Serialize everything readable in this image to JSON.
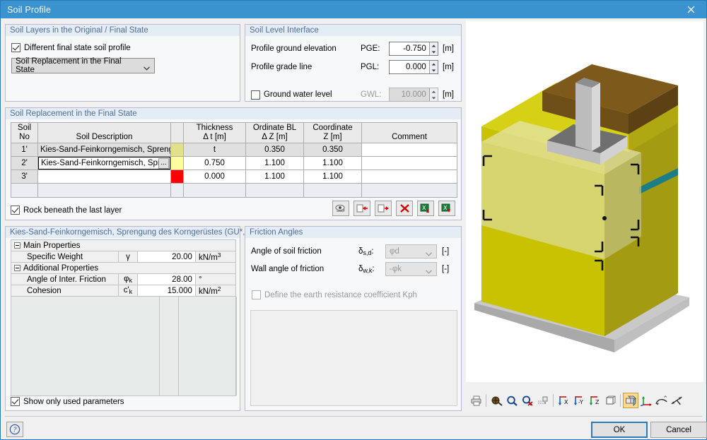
{
  "window": {
    "title": "Soil Profile",
    "close_icon": "close-icon"
  },
  "soil_layers_group": {
    "legend": "Soil Layers in the Original / Final State",
    "different_profile_checkbox": {
      "label": "Different final state soil profile",
      "checked": true
    },
    "state_select": {
      "value": "Soil Replacement in the Final State"
    }
  },
  "soil_level_group": {
    "legend": "Soil Level Interface",
    "rows": [
      {
        "label": "Profile ground elevation",
        "symbol": "PGE:",
        "value": "-0.750",
        "unit": "[m]",
        "enabled": true
      },
      {
        "label": "Profile grade line",
        "symbol": "PGL:",
        "value": "0.000",
        "unit": "[m]",
        "enabled": true
      }
    ],
    "gwl": {
      "checkbox_label": "Ground water level",
      "checked": false,
      "symbol": "GWL:",
      "value": "10.000",
      "unit": "[m]",
      "enabled": false
    }
  },
  "replacement_group": {
    "legend": "Soil Replacement in the Final State",
    "headers": {
      "soil_no_l1": "Soil",
      "soil_no_l2": "No",
      "description": "Soil Description",
      "color": "",
      "thickness_l1": "Thickness",
      "thickness_l2": "Δ t [m]",
      "ordinate_l1": "Ordinate BL",
      "ordinate_l2": "Δ Z [m]",
      "coordinate_l1": "Coordinate",
      "coordinate_l2": "Z [m]",
      "comment": "Comment"
    },
    "rows": [
      {
        "no": "1'",
        "description": "Kies-Sand-Feinkorngemisch, Sprengu",
        "color": "#e3e08a",
        "thickness": "t",
        "ordinate": "0.350",
        "coordinate": "0.350",
        "comment": "",
        "editing": false
      },
      {
        "no": "2'",
        "description": "Kies-Sand-Feinkorngemisch, Sprenc",
        "color": "#fcfca0",
        "thickness": "0.750",
        "ordinate": "1.100",
        "coordinate": "1.100",
        "comment": "",
        "editing": true,
        "ellipsis": "..."
      },
      {
        "no": "3'",
        "description": "",
        "color": "#fe0000",
        "thickness": "0.000",
        "ordinate": "1.100",
        "coordinate": "1.100",
        "comment": "",
        "editing": false
      }
    ],
    "rock_checkbox": {
      "label": "Rock beneath the last layer",
      "checked": true
    },
    "toolbar": [
      {
        "name": "visibility-button",
        "icon": "eye-icon"
      },
      {
        "name": "insert-row-before-button",
        "icon": "insert-left-icon"
      },
      {
        "name": "insert-row-after-button",
        "icon": "insert-right-icon"
      },
      {
        "name": "delete-row-button",
        "icon": "red-x-icon"
      },
      {
        "name": "import-excel-button",
        "icon": "excel-import-icon"
      },
      {
        "name": "export-excel-button",
        "icon": "excel-export-icon"
      }
    ]
  },
  "properties_group": {
    "legend": "Kies-Sand-Feinkorngemisch, Sprengung des Korngerüstes (GU*, G)",
    "sections": [
      {
        "type": "group",
        "label": "Main Properties"
      },
      {
        "type": "row",
        "label": "Specific Weight",
        "symbol": "γ",
        "value": "20.00",
        "unit_main": "kN/m",
        "unit_sup": "3"
      },
      {
        "type": "group",
        "label": "Additional Properties"
      },
      {
        "type": "row",
        "label": "Angle of Inter. Friction",
        "symbol": "φ",
        "symbol_sub": "k",
        "value": "28.00",
        "unit_main": "°",
        "unit_sup": ""
      },
      {
        "type": "row",
        "label": "Cohesion",
        "symbol": "c'",
        "symbol_sub": "k",
        "value": "15.000",
        "unit_main": "kN/m",
        "unit_sup": "2"
      }
    ],
    "show_only_used": {
      "label": "Show only used parameters",
      "checked": true
    }
  },
  "friction_group": {
    "legend": "Friction Angles",
    "rows": [
      {
        "label": "Angle of soil friction",
        "symbol": "δ",
        "symbol_sub": "s,d",
        "colon": ":",
        "value": "φd",
        "unit": "[-]",
        "enabled": false
      },
      {
        "label": "Wall angle of friction",
        "symbol": "δ",
        "symbol_sub": "w,k",
        "colon": ":",
        "value": "-φk",
        "unit": "[-]",
        "enabled": false
      }
    ],
    "kph_checkbox": {
      "label": "Define the earth resistance coefficient Kph",
      "checked": false,
      "enabled": false
    }
  },
  "viewport": {
    "toolbar": [
      {
        "name": "print-button",
        "icon": "printer-icon",
        "active": false
      },
      {
        "name": "render-button",
        "icon": "render-icon",
        "active": false
      },
      {
        "name": "zoom-in-button",
        "icon": "magnifier-icon",
        "active": false
      },
      {
        "name": "zoom-out-button",
        "icon": "magnifier-cancel-icon",
        "active": false
      },
      {
        "name": "grid-snap-button",
        "icon": "grid-icon",
        "active": false
      },
      {
        "name": "view-x-button",
        "icon": "axis-x-icon",
        "active": false
      },
      {
        "name": "view-y-button",
        "icon": "axis-y-icon",
        "active": false
      },
      {
        "name": "view-z-button",
        "icon": "axis-z-icon",
        "active": false
      },
      {
        "name": "view-box-button",
        "icon": "cube-icon",
        "active": false
      },
      {
        "name": "view-iso-button",
        "icon": "iso-cubes-icon",
        "active": true
      },
      {
        "name": "show-axes-button",
        "icon": "axes-icon",
        "active": false
      },
      {
        "name": "rotate-button",
        "icon": "rotate-arrow-icon",
        "active": false
      },
      {
        "name": "pan-button",
        "icon": "pan-arrows-icon",
        "active": false
      }
    ]
  },
  "footer": {
    "help_button": {
      "icon": "help-icon"
    },
    "ok_button": "OK",
    "cancel_button": "Cancel"
  }
}
